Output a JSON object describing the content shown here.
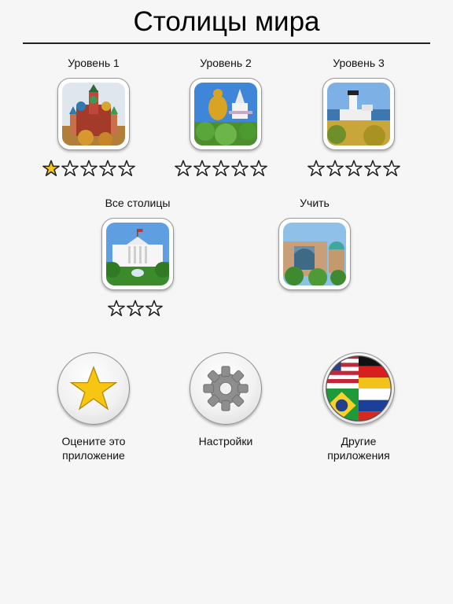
{
  "title": "Столицы мира",
  "levels": [
    {
      "label": "Уровень 1",
      "stars_total": 5,
      "stars_filled": 1
    },
    {
      "label": "Уровень 2",
      "stars_total": 5,
      "stars_filled": 0
    },
    {
      "label": "Уровень 3",
      "stars_total": 5,
      "stars_filled": 0
    }
  ],
  "all_capitals": {
    "label": "Все столицы",
    "stars_total": 3,
    "stars_filled": 0
  },
  "learn": {
    "label": "Учить"
  },
  "actions": {
    "rate": {
      "line1": "Оцените это",
      "line2": "приложение",
      "icon": "star-icon"
    },
    "settings": {
      "line1": "Настройки",
      "icon": "gear-icon"
    },
    "other_apps": {
      "line1": "Другие",
      "line2": "приложения",
      "icon": "flags-icon"
    }
  },
  "colors": {
    "star_fill": "#f5c518",
    "star_stroke": "#222222",
    "rate_star": "#f7c613",
    "gear": "#8e8e8e"
  }
}
